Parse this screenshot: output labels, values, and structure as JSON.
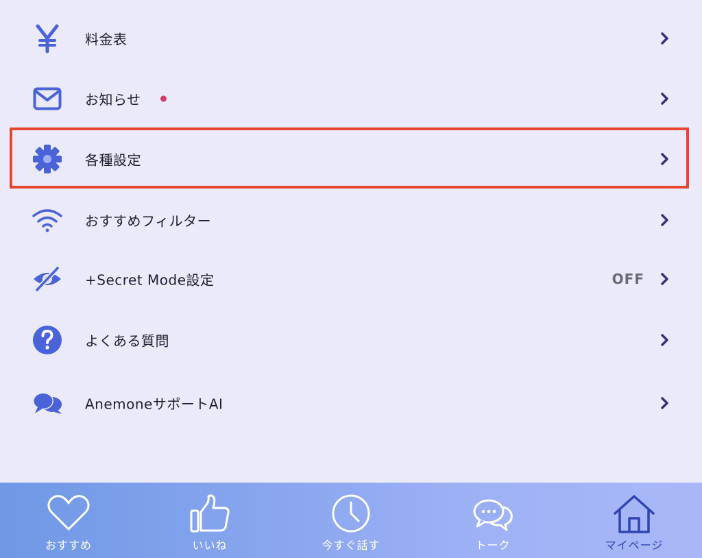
{
  "menu": {
    "items": [
      {
        "label": "料金表",
        "icon": "yen-icon"
      },
      {
        "label": "お知らせ",
        "icon": "mail-icon",
        "badge": "unread-dot"
      },
      {
        "label": "各種設定",
        "icon": "gear-icon",
        "highlighted": true
      },
      {
        "label": "おすすめフィルター",
        "icon": "wifi-icon"
      },
      {
        "label": "+Secret Mode設定",
        "icon": "eye-slash-icon",
        "value": "OFF"
      },
      {
        "label": "よくある質問",
        "icon": "question-icon"
      },
      {
        "label": "AnemoneサポートAI",
        "icon": "chat-bubbles-icon"
      }
    ]
  },
  "tabbar": {
    "tabs": [
      {
        "label": "おすすめ",
        "icon": "heart-icon"
      },
      {
        "label": "いいね",
        "icon": "thumbs-up-icon"
      },
      {
        "label": "今すぐ話す",
        "icon": "clock-icon"
      },
      {
        "label": "トーク",
        "icon": "chat-icon"
      },
      {
        "label": "マイページ",
        "icon": "home-icon",
        "active": true
      }
    ]
  },
  "colors": {
    "background": "#ebeafa",
    "icon_blue": "#4a63d8",
    "chevron": "#3a2e7a",
    "highlight_border": "#e8452e",
    "badge_dot": "#d0396b",
    "active_tab": "#2f43b2"
  }
}
